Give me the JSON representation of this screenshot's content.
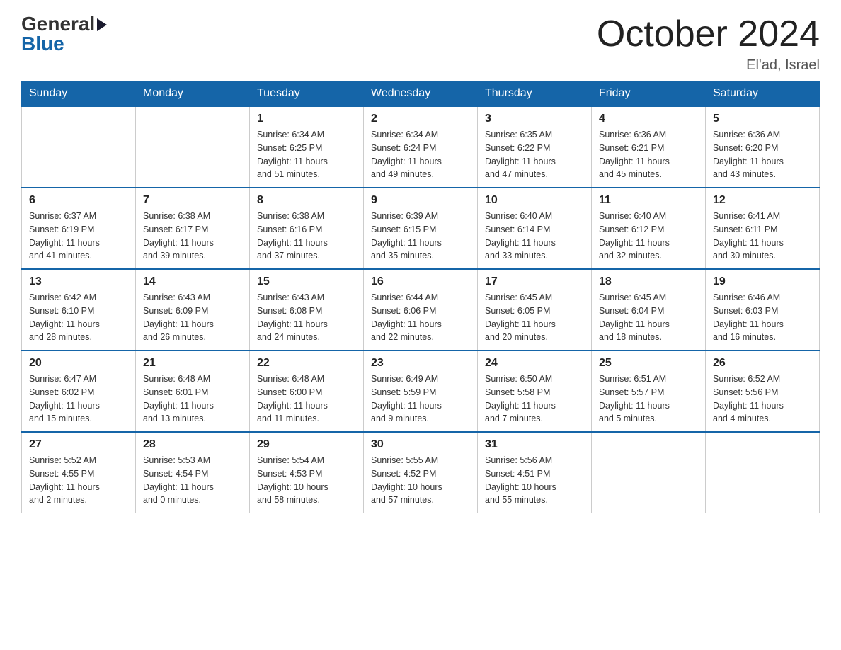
{
  "header": {
    "logo_general": "General",
    "logo_blue": "Blue",
    "month_title": "October 2024",
    "location": "El'ad, Israel"
  },
  "days_of_week": [
    "Sunday",
    "Monday",
    "Tuesday",
    "Wednesday",
    "Thursday",
    "Friday",
    "Saturday"
  ],
  "weeks": [
    [
      {
        "day": "",
        "info": ""
      },
      {
        "day": "",
        "info": ""
      },
      {
        "day": "1",
        "info": "Sunrise: 6:34 AM\nSunset: 6:25 PM\nDaylight: 11 hours\nand 51 minutes."
      },
      {
        "day": "2",
        "info": "Sunrise: 6:34 AM\nSunset: 6:24 PM\nDaylight: 11 hours\nand 49 minutes."
      },
      {
        "day": "3",
        "info": "Sunrise: 6:35 AM\nSunset: 6:22 PM\nDaylight: 11 hours\nand 47 minutes."
      },
      {
        "day": "4",
        "info": "Sunrise: 6:36 AM\nSunset: 6:21 PM\nDaylight: 11 hours\nand 45 minutes."
      },
      {
        "day": "5",
        "info": "Sunrise: 6:36 AM\nSunset: 6:20 PM\nDaylight: 11 hours\nand 43 minutes."
      }
    ],
    [
      {
        "day": "6",
        "info": "Sunrise: 6:37 AM\nSunset: 6:19 PM\nDaylight: 11 hours\nand 41 minutes."
      },
      {
        "day": "7",
        "info": "Sunrise: 6:38 AM\nSunset: 6:17 PM\nDaylight: 11 hours\nand 39 minutes."
      },
      {
        "day": "8",
        "info": "Sunrise: 6:38 AM\nSunset: 6:16 PM\nDaylight: 11 hours\nand 37 minutes."
      },
      {
        "day": "9",
        "info": "Sunrise: 6:39 AM\nSunset: 6:15 PM\nDaylight: 11 hours\nand 35 minutes."
      },
      {
        "day": "10",
        "info": "Sunrise: 6:40 AM\nSunset: 6:14 PM\nDaylight: 11 hours\nand 33 minutes."
      },
      {
        "day": "11",
        "info": "Sunrise: 6:40 AM\nSunset: 6:12 PM\nDaylight: 11 hours\nand 32 minutes."
      },
      {
        "day": "12",
        "info": "Sunrise: 6:41 AM\nSunset: 6:11 PM\nDaylight: 11 hours\nand 30 minutes."
      }
    ],
    [
      {
        "day": "13",
        "info": "Sunrise: 6:42 AM\nSunset: 6:10 PM\nDaylight: 11 hours\nand 28 minutes."
      },
      {
        "day": "14",
        "info": "Sunrise: 6:43 AM\nSunset: 6:09 PM\nDaylight: 11 hours\nand 26 minutes."
      },
      {
        "day": "15",
        "info": "Sunrise: 6:43 AM\nSunset: 6:08 PM\nDaylight: 11 hours\nand 24 minutes."
      },
      {
        "day": "16",
        "info": "Sunrise: 6:44 AM\nSunset: 6:06 PM\nDaylight: 11 hours\nand 22 minutes."
      },
      {
        "day": "17",
        "info": "Sunrise: 6:45 AM\nSunset: 6:05 PM\nDaylight: 11 hours\nand 20 minutes."
      },
      {
        "day": "18",
        "info": "Sunrise: 6:45 AM\nSunset: 6:04 PM\nDaylight: 11 hours\nand 18 minutes."
      },
      {
        "day": "19",
        "info": "Sunrise: 6:46 AM\nSunset: 6:03 PM\nDaylight: 11 hours\nand 16 minutes."
      }
    ],
    [
      {
        "day": "20",
        "info": "Sunrise: 6:47 AM\nSunset: 6:02 PM\nDaylight: 11 hours\nand 15 minutes."
      },
      {
        "day": "21",
        "info": "Sunrise: 6:48 AM\nSunset: 6:01 PM\nDaylight: 11 hours\nand 13 minutes."
      },
      {
        "day": "22",
        "info": "Sunrise: 6:48 AM\nSunset: 6:00 PM\nDaylight: 11 hours\nand 11 minutes."
      },
      {
        "day": "23",
        "info": "Sunrise: 6:49 AM\nSunset: 5:59 PM\nDaylight: 11 hours\nand 9 minutes."
      },
      {
        "day": "24",
        "info": "Sunrise: 6:50 AM\nSunset: 5:58 PM\nDaylight: 11 hours\nand 7 minutes."
      },
      {
        "day": "25",
        "info": "Sunrise: 6:51 AM\nSunset: 5:57 PM\nDaylight: 11 hours\nand 5 minutes."
      },
      {
        "day": "26",
        "info": "Sunrise: 6:52 AM\nSunset: 5:56 PM\nDaylight: 11 hours\nand 4 minutes."
      }
    ],
    [
      {
        "day": "27",
        "info": "Sunrise: 5:52 AM\nSunset: 4:55 PM\nDaylight: 11 hours\nand 2 minutes."
      },
      {
        "day": "28",
        "info": "Sunrise: 5:53 AM\nSunset: 4:54 PM\nDaylight: 11 hours\nand 0 minutes."
      },
      {
        "day": "29",
        "info": "Sunrise: 5:54 AM\nSunset: 4:53 PM\nDaylight: 10 hours\nand 58 minutes."
      },
      {
        "day": "30",
        "info": "Sunrise: 5:55 AM\nSunset: 4:52 PM\nDaylight: 10 hours\nand 57 minutes."
      },
      {
        "day": "31",
        "info": "Sunrise: 5:56 AM\nSunset: 4:51 PM\nDaylight: 10 hours\nand 55 minutes."
      },
      {
        "day": "",
        "info": ""
      },
      {
        "day": "",
        "info": ""
      }
    ]
  ]
}
